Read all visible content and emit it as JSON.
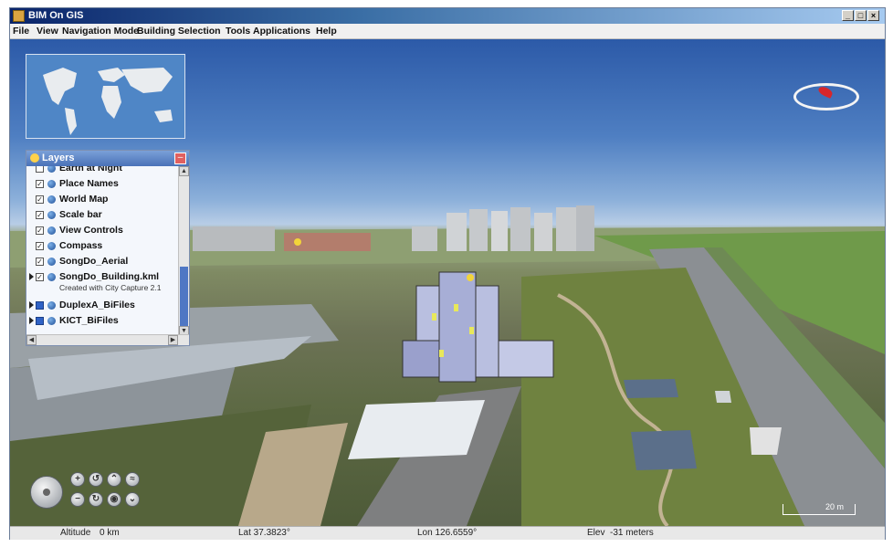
{
  "window": {
    "title": "BIM On GIS",
    "controls": [
      "_",
      "□",
      "×"
    ]
  },
  "menu": [
    "File",
    "View",
    "Navigation Mode",
    "Building Selection",
    "Tools",
    "Applications",
    "Help"
  ],
  "layers_panel": {
    "title": "Layers",
    "items": [
      {
        "label": "Earth at Night",
        "checked": false,
        "expandable": false
      },
      {
        "label": "Place Names",
        "checked": true,
        "expandable": false
      },
      {
        "label": "World Map",
        "checked": true,
        "expandable": false
      },
      {
        "label": "Scale bar",
        "checked": true,
        "expandable": false
      },
      {
        "label": "View Controls",
        "checked": true,
        "expandable": false
      },
      {
        "label": "Compass",
        "checked": true,
        "expandable": false
      },
      {
        "label": "SongDo_Aerial",
        "checked": true,
        "expandable": false
      },
      {
        "label": "SongDo_Building.kml",
        "checked": true,
        "expandable": true,
        "sublabel": "Created with City Capture 2.1"
      },
      {
        "label": "DuplexA_BiFiles",
        "checked": true,
        "expandable": true
      },
      {
        "label": "KICT_BiFiles",
        "checked": true,
        "expandable": true
      }
    ]
  },
  "scale_bar": {
    "label": "20 m"
  },
  "status": {
    "altitude_label": "Altitude",
    "altitude_value": "0 km",
    "lat": "Lat 37.3823°",
    "lon": "Lon 126.6559°",
    "elev_label": "Elev",
    "elev_value": "-31 meters"
  },
  "nav_controls": {
    "icons": [
      "pan-icon",
      "zoom-in-icon",
      "rotate-left-icon",
      "tilt-up-icon",
      "look-around-icon",
      "zoom-out-icon",
      "rotate-right-icon",
      "reset-icon",
      "tilt-down-icon"
    ]
  },
  "colors": {
    "sky": "#4f7fc2",
    "panel_header": "#4a72b8",
    "compass_needle": "#d8262a"
  }
}
